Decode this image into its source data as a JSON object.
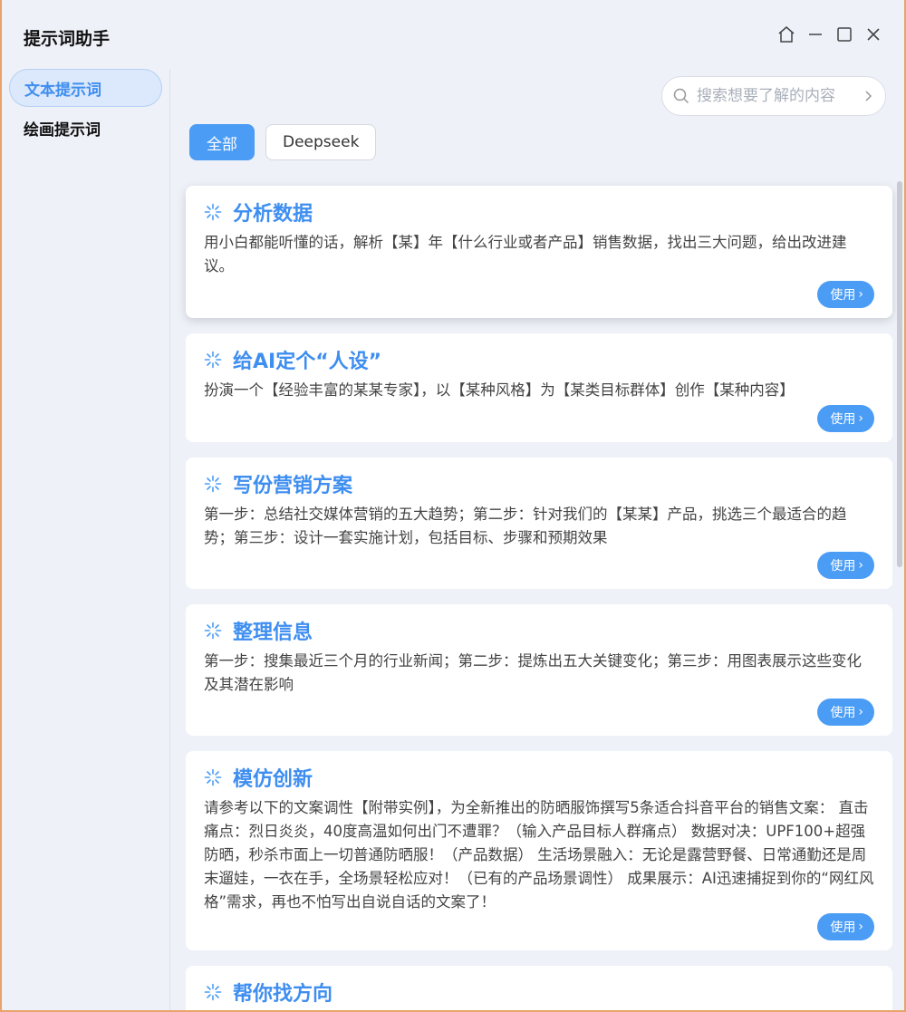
{
  "app": {
    "title": "提示词助手"
  },
  "sidebar": {
    "items": [
      {
        "label": "文本提示词"
      },
      {
        "label": "绘画提示词"
      }
    ]
  },
  "search": {
    "placeholder": "搜索想要了解的内容"
  },
  "filters": [
    {
      "label": "全部"
    },
    {
      "label": "Deepseek"
    }
  ],
  "use_label": "使用",
  "cards": [
    {
      "title": "分析数据",
      "desc": "用小白都能听懂的话，解析【某】年【什么行业或者产品】销售数据，找出三大问题，给出改进建议。"
    },
    {
      "title": "给AI定个“人设”",
      "desc": "扮演一个【经验丰富的某某专家】，以【某种风格】为【某类目标群体】创作【某种内容】"
    },
    {
      "title": "写份营销方案",
      "desc": "第一步：总结社交媒体营销的五大趋势；第二步：针对我们的【某某】产品，挑选三个最适合的趋势；第三步：设计一套实施计划，包括目标、步骤和预期效果"
    },
    {
      "title": "整理信息",
      "desc": "第一步：搜集最近三个月的行业新闻；第二步：提炼出五大关键变化；第三步：用图表展示这些变化及其潜在影响"
    },
    {
      "title": "模仿创新",
      "desc": "请参考以下的文案调性【附带实例】，为全新推出的防晒服饰撰写5条适合抖音平台的销售文案： 直击痛点：烈日炎炎，40度高温如何出门不遭罪？（输入产品目标人群痛点） 数据对决：UPF100+超强防晒，秒杀市面上一切普通防晒服！（产品数据） 生活场景融入：无论是露营野餐、日常通勤还是周末遛娃，一衣在手，全场景轻松应对！（已有的产品场景调性） 成果展示：AI迅速捕捉到你的“网红风格”需求，再也不怕写出自说自话的文案了！"
    },
    {
      "title": "帮你找方向",
      "desc": ""
    }
  ]
}
